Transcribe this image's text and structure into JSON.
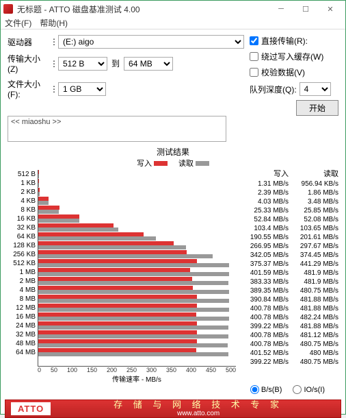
{
  "window": {
    "title": "无标题 - ATTO 磁盘基准测试 4.00"
  },
  "menu": {
    "file": "文件(F)",
    "help": "帮助(H)"
  },
  "labels": {
    "drive": "驱动器",
    "transfer_size": "传输大小(Z)",
    "to": "到",
    "file_size": "文件大小(F):",
    "queue_depth": "队列深度(Q):"
  },
  "values": {
    "drive": "(E:) aigo",
    "tsize_from": "512 B",
    "tsize_to": "64 MB",
    "file_size": "1 GB",
    "queue_depth": "4",
    "desc": "<< miaoshu >>"
  },
  "checks": {
    "direct": "直接传输(R):",
    "bypass_cache": "绕过写入缓存(W)",
    "verify": "校验数据(V)"
  },
  "buttons": {
    "start": "开始"
  },
  "results": {
    "title": "测试结果",
    "write_legend": "写入",
    "read_legend": "读取",
    "write_hdr": "写入",
    "read_hdr": "读取",
    "xaxis_label": "传输速率 - MB/s",
    "radio_bs": "B/s(B)",
    "radio_ios": "IO/s(I)"
  },
  "footer": {
    "logo": "ATTO",
    "tagline": "存 储 与 网 络 技 术 专 家",
    "url": "www.atto.com"
  },
  "chart_data": {
    "type": "bar",
    "xlabel": "传输速率 - MB/s",
    "xlim": [
      0,
      500
    ],
    "xticks": [
      0,
      50,
      100,
      150,
      200,
      250,
      300,
      350,
      400,
      450,
      500
    ],
    "categories": [
      "512 B",
      "1 KB",
      "2 KB",
      "4 KB",
      "8 KB",
      "16 KB",
      "32 KB",
      "64 KB",
      "128 KB",
      "256 KB",
      "512 KB",
      "1 MB",
      "2 MB",
      "4 MB",
      "8 MB",
      "12 MB",
      "16 MB",
      "24 MB",
      "32 MB",
      "48 MB",
      "64 MB"
    ],
    "series": [
      {
        "name": "写入",
        "unit": "MB/s",
        "values": [
          1.31,
          2.39,
          4.03,
          25.33,
          52.84,
          103.4,
          190.55,
          266.95,
          342.05,
          375.37,
          401.59,
          383.33,
          389.35,
          390.84,
          400.78,
          400.78,
          399.22,
          400.78,
          400.78,
          401.52,
          399.22
        ]
      },
      {
        "name": "读取",
        "unit": "MB/s",
        "values": [
          956.94,
          1.86,
          3.48,
          25.85,
          52.08,
          103.65,
          201.61,
          297.67,
          374.45,
          441.29,
          481.9,
          481.9,
          480.75,
          481.88,
          481.88,
          482.24,
          481.88,
          481.12,
          480.75,
          480,
          480.75
        ],
        "unit_override": {
          "0": "KB/s"
        }
      }
    ]
  }
}
